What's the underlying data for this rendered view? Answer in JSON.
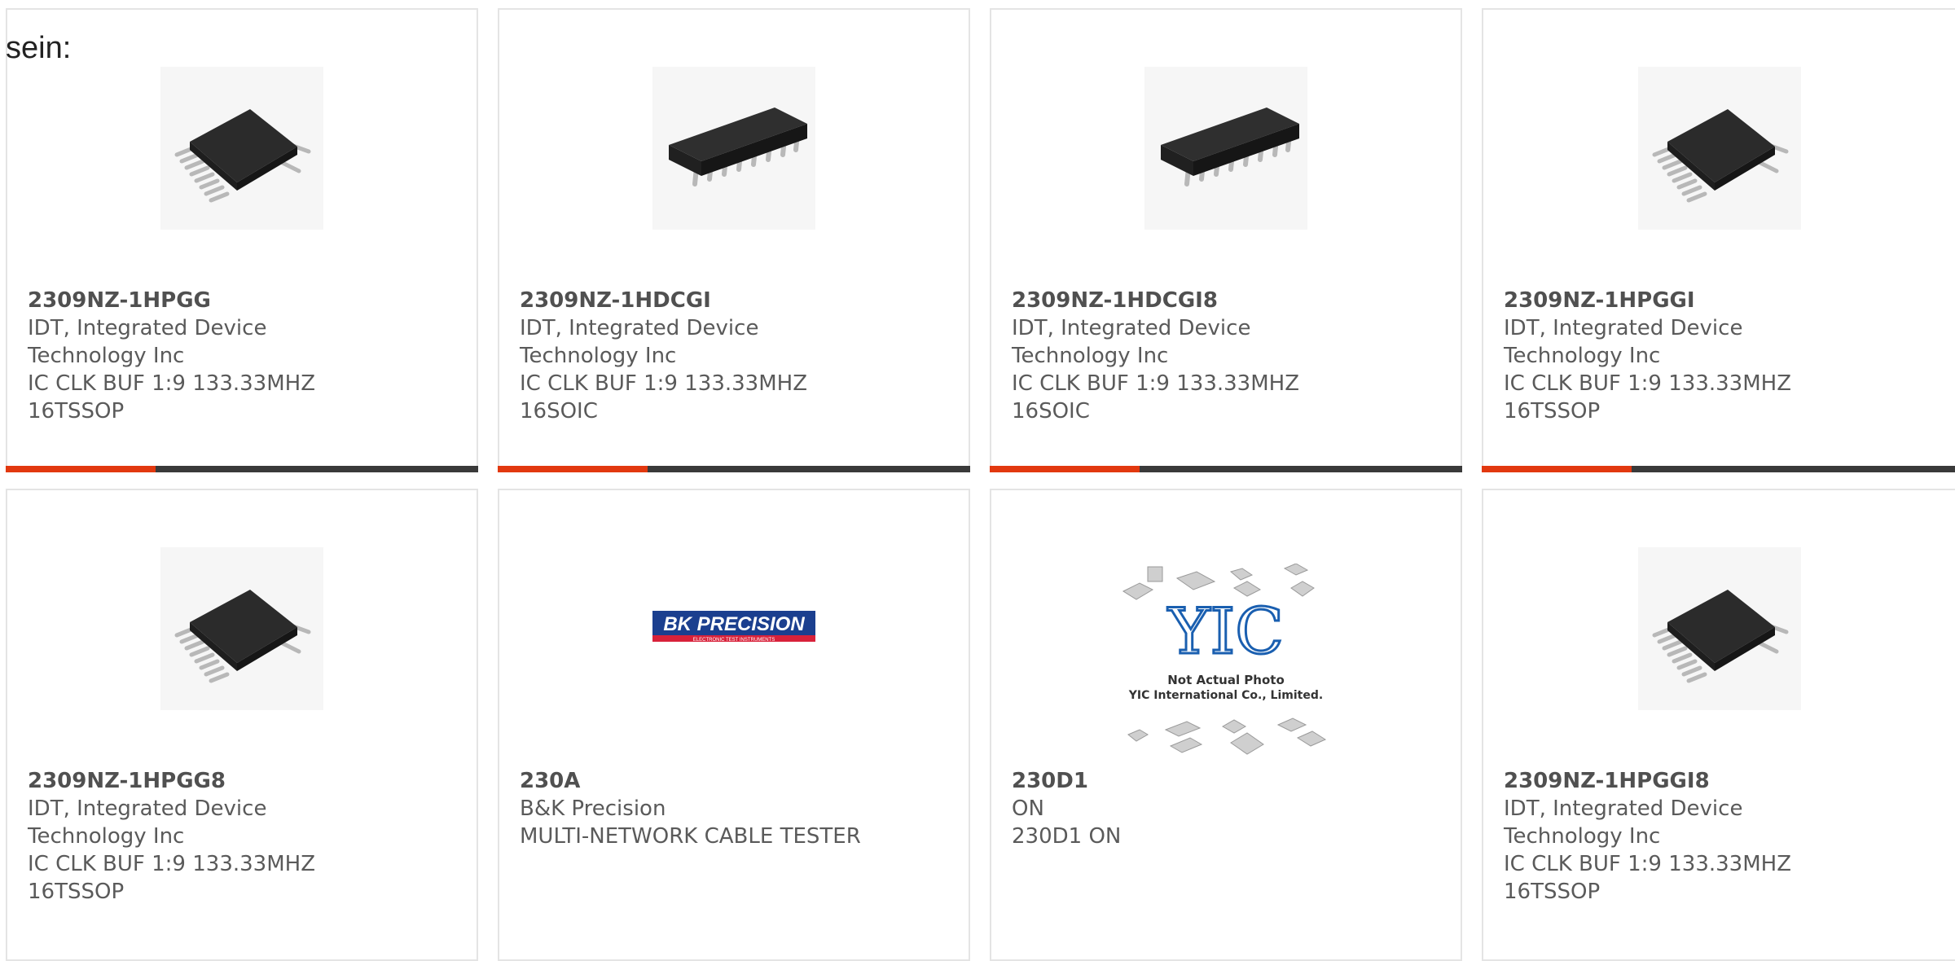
{
  "intro_text": "sein:",
  "accent_color": "#e2380f",
  "products": [
    {
      "part": "2309NZ-1HPGG",
      "maker_lines": [
        "IDT, Integrated Device",
        "Technology Inc"
      ],
      "desc_lines": [
        "IC CLK BUF 1:9 133.33MHZ",
        "16TSSOP"
      ],
      "image_icon": "tssop-chip-image"
    },
    {
      "part": "2309NZ-1HDCGI",
      "maker_lines": [
        "IDT, Integrated Device",
        "Technology Inc"
      ],
      "desc_lines": [
        "IC CLK BUF 1:9 133.33MHZ",
        "16SOIC"
      ],
      "image_icon": "soic-chip-image"
    },
    {
      "part": "2309NZ-1HDCGI8",
      "maker_lines": [
        "IDT, Integrated Device",
        "Technology Inc"
      ],
      "desc_lines": [
        "IC CLK BUF 1:9 133.33MHZ",
        "16SOIC"
      ],
      "image_icon": "soic-chip-image"
    },
    {
      "part": "2309NZ-1HPGGI",
      "maker_lines": [
        "IDT, Integrated Device",
        "Technology Inc"
      ],
      "desc_lines": [
        "IC CLK BUF 1:9 133.33MHZ",
        "16TSSOP"
      ],
      "image_icon": "tssop-chip-image"
    },
    {
      "part": "2309NZ-1HPGG8",
      "maker_lines": [
        "IDT, Integrated Device",
        "Technology Inc"
      ],
      "desc_lines": [
        "IC CLK BUF 1:9 133.33MHZ",
        "16TSSOP"
      ],
      "image_icon": "tssop-chip-image"
    },
    {
      "part": "230A",
      "maker_lines": [
        "B&K Precision"
      ],
      "desc_lines": [
        "MULTI-NETWORK CABLE TESTER"
      ],
      "image_icon": "bk-precision-logo",
      "logo_text": "BK PRECISION",
      "logo_sub": "ELECTRONIC TEST INSTRUMENTS"
    },
    {
      "part": "230D1",
      "maker_lines": [
        "ON"
      ],
      "desc_lines": [
        "230D1 ON"
      ],
      "image_icon": "yic-placeholder-image",
      "placeholder_lines": [
        "Not Actual Photo",
        "YIC International Co., Limited."
      ]
    },
    {
      "part": "2309NZ-1HPGGI8",
      "maker_lines": [
        "IDT, Integrated Device",
        "Technology Inc"
      ],
      "desc_lines": [
        "IC CLK BUF 1:9 133.33MHZ",
        "16TSSOP"
      ],
      "image_icon": "tssop-chip-image"
    }
  ]
}
